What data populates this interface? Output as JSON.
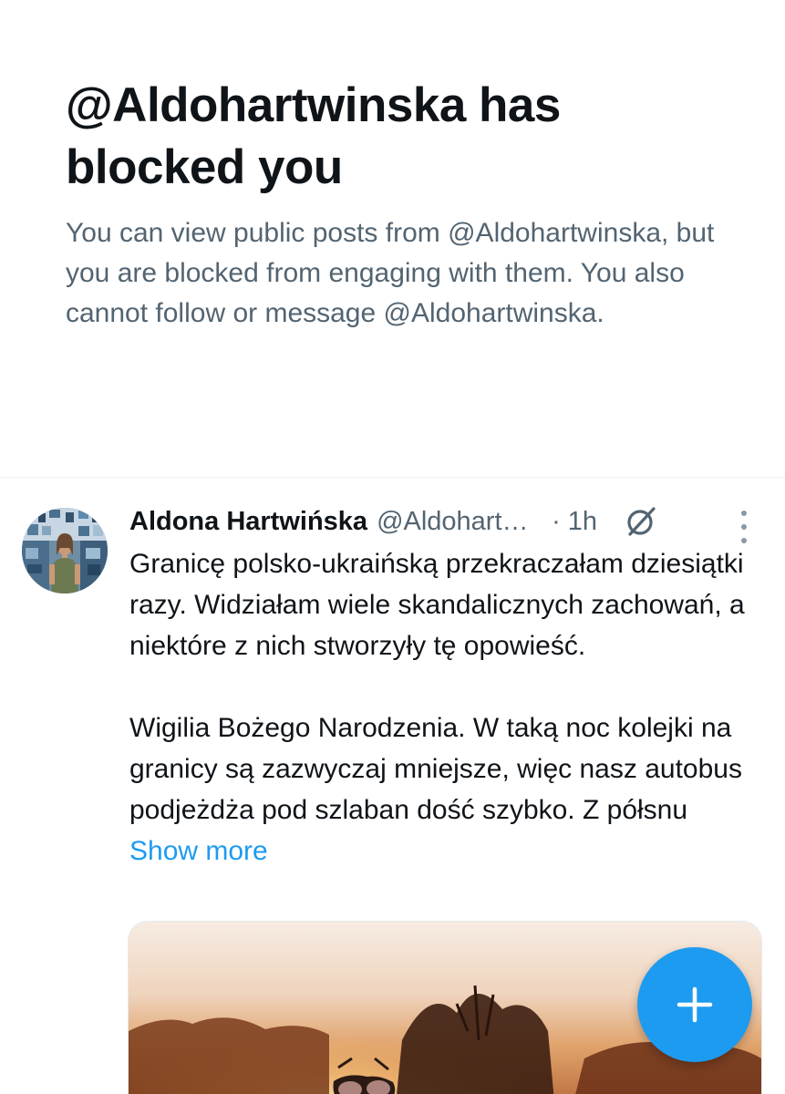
{
  "block_notice": {
    "title": "@Aldohartwinska has blocked you",
    "description": "You can view public posts from @Aldohartwinska, but you are blocked from engaging with them. You also cannot follow or message @Aldohartwinska."
  },
  "post": {
    "author_name": "Aldona Hartwińska",
    "author_handle": "@Aldohartwinska",
    "time": "· 1h",
    "paragraph_1": "Granicę polsko-ukraińską przekraczałam dziesiątki razy. Widziałam wiele skandalicznych zachowań, a niektóre z nich stworzyły tę opowieść.",
    "paragraph_2": "Wigilia Bożego Narodzenia. W taką noc kolejki na granicy są zazwyczaj mniejsze, więc nasz autobus podjeżdża pod szlaban dość szybko. Z półsnu",
    "show_more": "Show more",
    "icons": {
      "grok": "grok-icon",
      "more": "more-vertical-icon"
    }
  },
  "fab": {
    "icon": "plus-icon"
  },
  "colors": {
    "accent": "#1d9bf0",
    "text_primary": "#0f1419",
    "text_secondary": "#536471",
    "divider": "#eff3f4"
  }
}
